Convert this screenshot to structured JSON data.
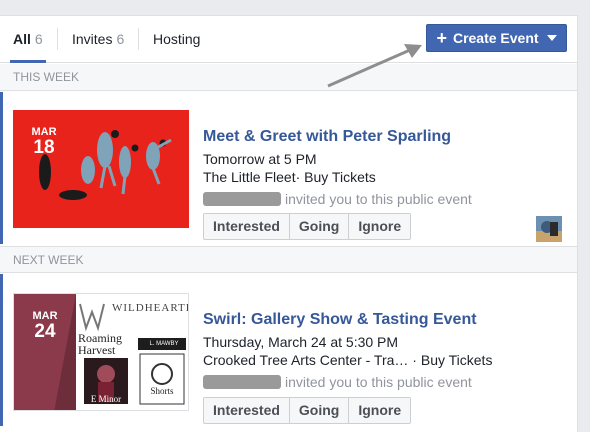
{
  "tabs": [
    {
      "label": "All",
      "count": "6"
    },
    {
      "label": "Invites",
      "count": "6"
    },
    {
      "label": "Hosting",
      "count": ""
    }
  ],
  "create_button": {
    "label": "Create Event",
    "icon": "plus-icon"
  },
  "sections": [
    {
      "heading": "THIS WEEK"
    },
    {
      "heading": "NEXT WEEK"
    }
  ],
  "events": [
    {
      "title": "Meet & Greet with Peter Sparling",
      "date_month": "MAR",
      "date_day": "18",
      "time": "Tomorrow at 5 PM",
      "venue": "The Little Fleet",
      "tickets": "Buy Tickets",
      "invited_text": "invited you to this public event",
      "buttons": [
        "Interested",
        "Going",
        "Ignore"
      ],
      "thumb_color": "#e8231c"
    },
    {
      "title": "Swirl: Gallery Show & Tasting Event",
      "date_month": "MAR",
      "date_day": "24",
      "time": "Thursday, March 24 at 5:30 PM",
      "venue": "Crooked Tree Arts Center - Tra…",
      "tickets": "Buy Tickets",
      "invited_text": "invited you to this public event",
      "buttons": [
        "Interested",
        "Going",
        "Ignore"
      ],
      "thumb_text": {
        "brand": "WILDHEARTED",
        "band1": "Roaming Harvest",
        "band2": "E Minor",
        "band3": "Shorts",
        "small": "L. MAWBY"
      }
    }
  ],
  "colors": {
    "accent": "#4267b2",
    "link": "#365899"
  }
}
